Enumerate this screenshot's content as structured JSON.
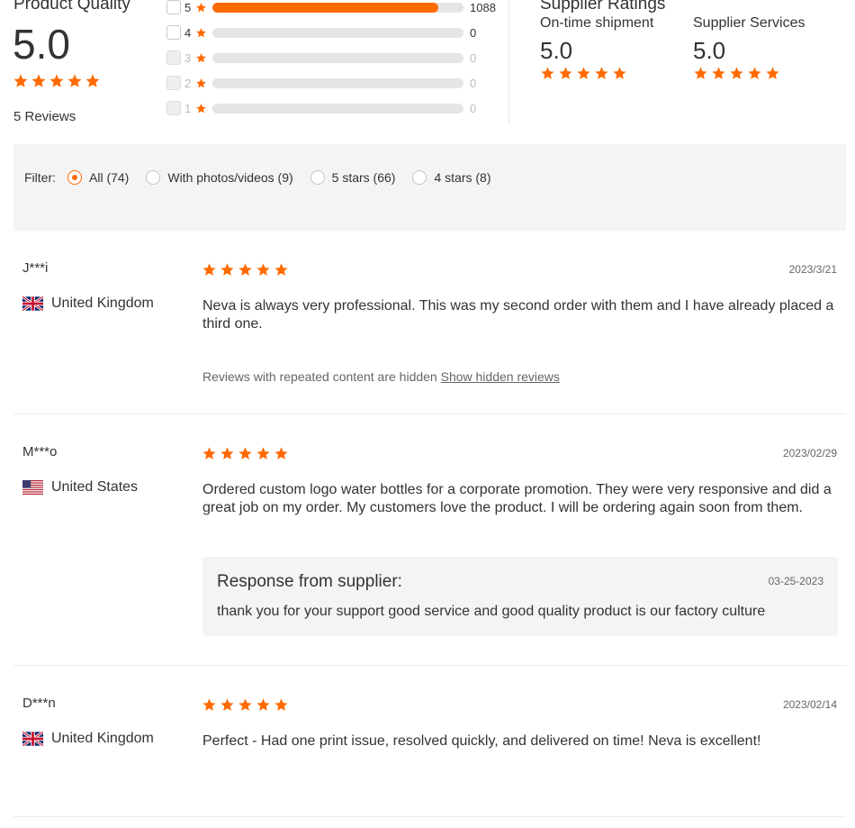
{
  "colors": {
    "accent": "#ff6a00",
    "star": "#ff6a00",
    "text": "#333333",
    "muted": "#666666",
    "panel_bg": "#f4f4f4",
    "bar_track": "#e5e5e5"
  },
  "product_quality": {
    "title": "Product Quality",
    "score": "5.0",
    "stars": 5,
    "reviews_label": "5 Reviews"
  },
  "distribution": [
    {
      "stars": "5",
      "count": "1088",
      "fraction": 0.9,
      "enabled": true
    },
    {
      "stars": "4",
      "count": "0",
      "fraction": 0,
      "enabled": true
    },
    {
      "stars": "3",
      "count": "0",
      "fraction": 0,
      "enabled": false
    },
    {
      "stars": "2",
      "count": "0",
      "fraction": 0,
      "enabled": false
    },
    {
      "stars": "1",
      "count": "0",
      "fraction": 0,
      "enabled": false
    }
  ],
  "supplier_ratings": {
    "title": "Supplier Ratings",
    "items": [
      {
        "label": "On-time shipment",
        "score": "5.0",
        "stars": 5
      },
      {
        "label": "Supplier Services",
        "score": "5.0",
        "stars": 5
      }
    ]
  },
  "filter": {
    "label": "Filter:",
    "options": [
      {
        "label": "All (74)",
        "checked": true
      },
      {
        "label": "With photos/videos (9)",
        "checked": false
      },
      {
        "label": "5 stars (66)",
        "checked": false
      },
      {
        "label": "4 stars (8)",
        "checked": false
      }
    ]
  },
  "reviews": [
    {
      "user": "J***i",
      "country": "United Kingdom",
      "flag_icon": "uk-flag-icon",
      "stars": 5,
      "date": "2023/3/21",
      "text": "Neva is always very professional. This was my second order with them and I have already placed a third one.",
      "hidden_note": "Reviews with repeated content are hidden",
      "hidden_link": "Show hidden reviews"
    },
    {
      "user": "M***o",
      "country": "United States",
      "flag_icon": "us-flag-icon",
      "stars": 5,
      "date": "2023/02/29",
      "text": "Ordered custom logo water bottles for a corporate promotion. They were very responsive and did a great job on my order. My customers love the product. I will be ordering again soon from them.",
      "response": {
        "title": "Response from supplier:",
        "date": "03-25-2023",
        "text": "thank you for your support good service and good quality product is our factory culture"
      }
    },
    {
      "user": "D***n",
      "country": "United Kingdom",
      "flag_icon": "uk-flag-icon",
      "stars": 5,
      "date": "2023/02/14",
      "text": "Perfect - Had one print issue, resolved quickly, and delivered on time! Neva is excellent!"
    }
  ]
}
